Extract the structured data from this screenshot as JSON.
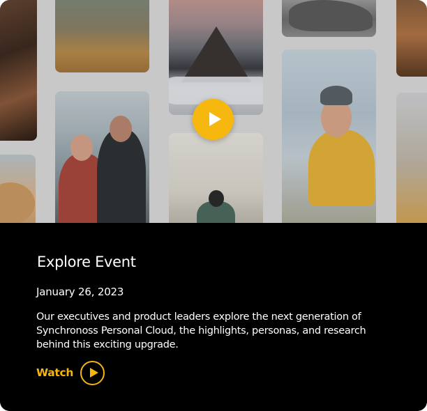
{
  "event": {
    "title": "Explore Event",
    "date": "January 26, 2023",
    "description": "Our executives and product leaders explore the next generation of Synchronoss Personal Cloud, the highlights, personas, and research behind this exciting upgrade.",
    "watch_label": "Watch"
  },
  "hero": {
    "play_icon": "play-icon",
    "accent_color": "#f6b70e"
  },
  "colors": {
    "background": "#000000",
    "text": "#ffffff",
    "accent": "#f5b60f"
  }
}
